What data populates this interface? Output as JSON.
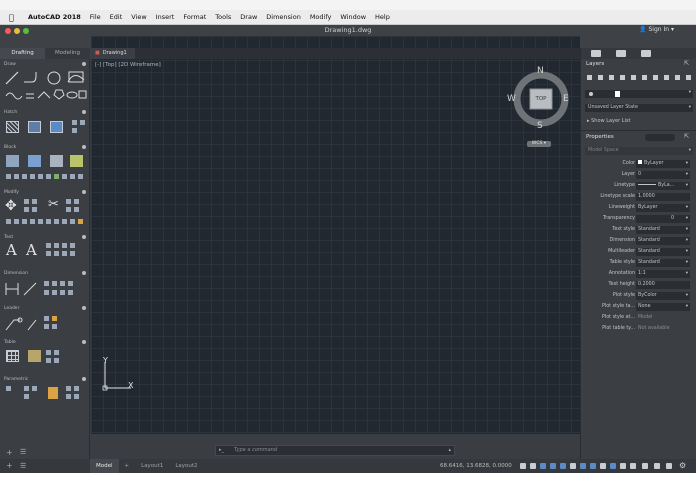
{
  "menubar": {
    "app": "AutoCAD 2018",
    "items": [
      "File",
      "Edit",
      "View",
      "Insert",
      "Format",
      "Tools",
      "Draw",
      "Dimension",
      "Modify",
      "Window",
      "Help"
    ]
  },
  "window": {
    "title": "Drawing1.dwg",
    "signin": "Sign In"
  },
  "palette": {
    "tabs": [
      "Drafting",
      "Modeling"
    ],
    "sections": [
      "Draw",
      "Hatch",
      "Block",
      "Modify",
      "Text",
      "Dimension",
      "Leader",
      "Table",
      "Parametric"
    ]
  },
  "document": {
    "tab": "Drawing1",
    "viewport_label": "[-] [Top] [2D Wireframe]"
  },
  "viewcube": {
    "north": "N",
    "south": "S",
    "east": "E",
    "west": "W",
    "face": "TOP",
    "wcs": "WCS"
  },
  "ucs": {
    "x": "X",
    "y": "Y"
  },
  "layers_panel": {
    "title": "Layers",
    "layer_state": "Unsaved Layer State",
    "show_layer_list": "Show Layer List"
  },
  "properties_panel": {
    "title": "Properties",
    "context": "Model Space",
    "rows": [
      {
        "name": "Color",
        "value": "ByLayer"
      },
      {
        "name": "Layer",
        "value": "0"
      },
      {
        "name": "Linetype",
        "value": "ByLa..."
      },
      {
        "name": "Linetype scale",
        "value": "1.0000"
      },
      {
        "name": "Lineweight",
        "value": "ByLayer"
      },
      {
        "name": "Transparency",
        "value": "0"
      },
      {
        "name": "Text style",
        "value": "Standard"
      },
      {
        "name": "Dimension",
        "value": "Standard"
      },
      {
        "name": "Multileader",
        "value": "Standard"
      },
      {
        "name": "Table style",
        "value": "Standard"
      },
      {
        "name": "Annotation",
        "value": "1:1"
      },
      {
        "name": "Text height",
        "value": "0.2000"
      },
      {
        "name": "Plot style",
        "value": "ByColor"
      },
      {
        "name": "Plot style ta...",
        "value": "None"
      },
      {
        "name": "Plot style at...",
        "value": "Model"
      },
      {
        "name": "Plot table ty...",
        "value": "Not available"
      }
    ]
  },
  "statusbar": {
    "tabs": [
      "Model",
      "+",
      "Layout1",
      "Layout2"
    ],
    "coords": "68.6416, 13.6828, 0.0000",
    "command_placeholder": "Type a command"
  },
  "colors": {
    "canvas": "#212830",
    "panel": "#3b3e43",
    "accent_layer_color_swatch": "#ffffff"
  }
}
